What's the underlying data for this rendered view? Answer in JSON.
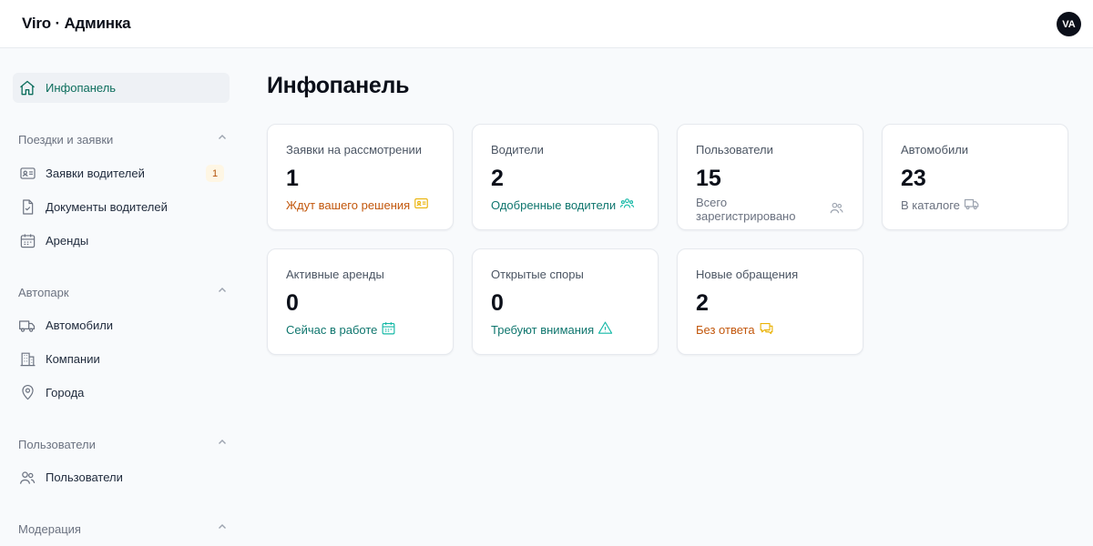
{
  "header": {
    "logo": "Viro · Админка",
    "avatar_initials": "VA"
  },
  "sidebar": {
    "dashboard_label": "Инфопанель",
    "sections": [
      {
        "title": "Поездки и заявки",
        "items": [
          {
            "label": "Заявки водителей",
            "icon": "id-card-icon",
            "badge": "1"
          },
          {
            "label": "Документы водителей",
            "icon": "document-check-icon"
          },
          {
            "label": "Аренды",
            "icon": "calendar-icon"
          }
        ]
      },
      {
        "title": "Автопарк",
        "items": [
          {
            "label": "Автомобили",
            "icon": "truck-icon"
          },
          {
            "label": "Компании",
            "icon": "building-icon"
          },
          {
            "label": "Города",
            "icon": "map-pin-icon"
          }
        ]
      },
      {
        "title": "Пользователи",
        "items": [
          {
            "label": "Пользователи",
            "icon": "users-icon"
          }
        ]
      },
      {
        "title": "Модерация",
        "items": []
      }
    ]
  },
  "main": {
    "title": "Инфопанель",
    "cards": [
      {
        "label": "Заявки на рассмотрении",
        "value": "1",
        "sub": "Ждут вашего решения",
        "sub_color": "#c2570c",
        "icon": "id-card-icon"
      },
      {
        "label": "Водители",
        "value": "2",
        "sub": "Одобренные водители",
        "sub_color": "#0f766e",
        "icon": "users-group-icon"
      },
      {
        "label": "Пользователи",
        "value": "15",
        "sub": "Всего зарегистрировано",
        "sub_color": "#6b7280",
        "icon": "users-icon"
      },
      {
        "label": "Автомобили",
        "value": "23",
        "sub": "В каталоге",
        "sub_color": "#6b7280",
        "icon": "truck-icon"
      },
      {
        "label": "Активные аренды",
        "value": "0",
        "sub": "Сейчас в работе",
        "sub_color": "#0f766e",
        "icon": "calendar-icon"
      },
      {
        "label": "Открытые споры",
        "value": "0",
        "sub": "Требуют внимания",
        "sub_color": "#0f766e",
        "icon": "warning-icon"
      },
      {
        "label": "Новые обращения",
        "value": "2",
        "sub": "Без ответа",
        "sub_color": "#c2570c",
        "icon": "chat-icon"
      }
    ]
  }
}
